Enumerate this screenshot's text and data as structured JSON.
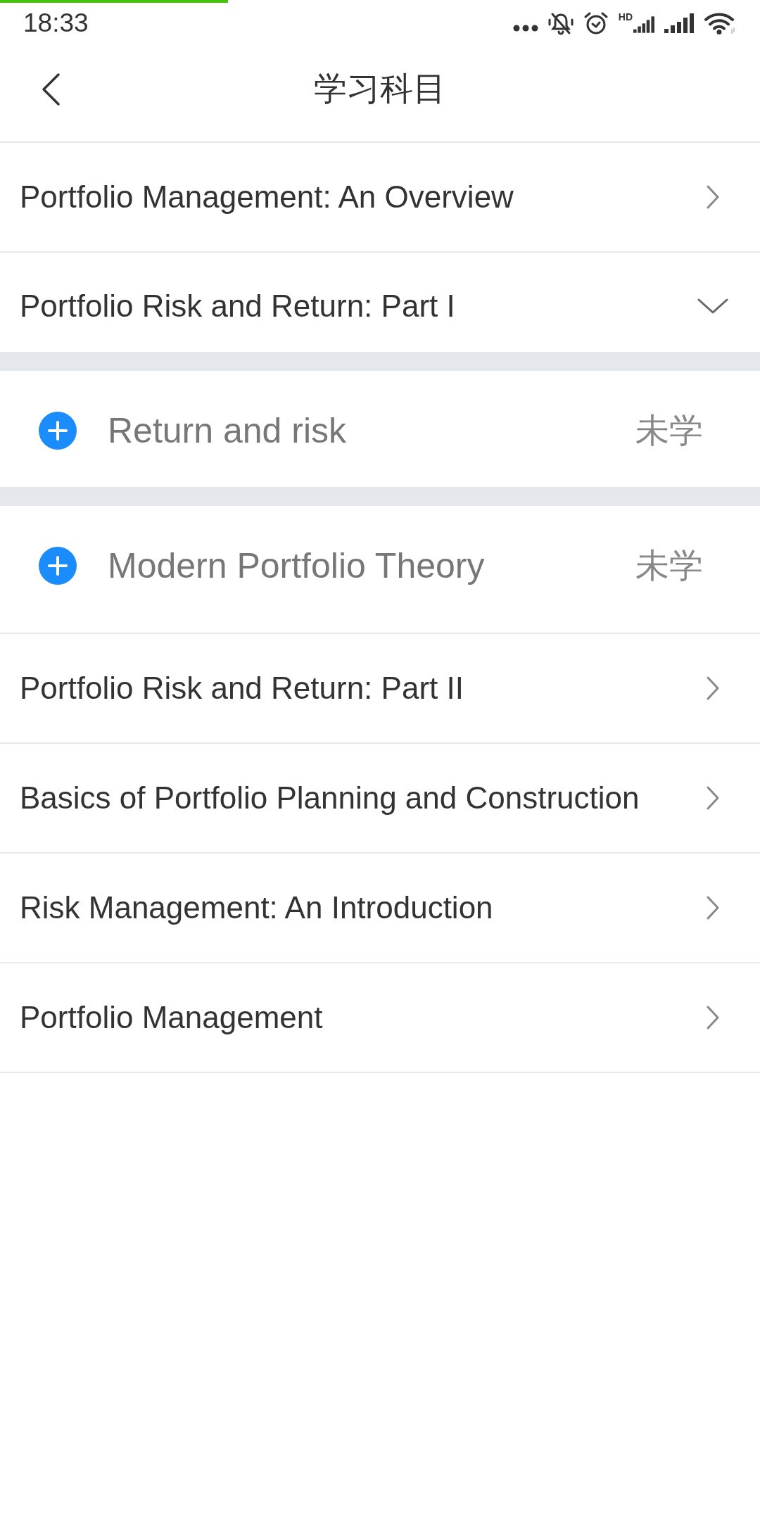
{
  "status_bar": {
    "time": "18:33",
    "network_type": "HD"
  },
  "loading_bar": {
    "level": 0.3
  },
  "header": {
    "title": "学习科目"
  },
  "chapters": [
    {
      "title": "Portfolio Management: An Overview",
      "expanded": false
    },
    {
      "title": "Portfolio Risk and Return: Part I",
      "expanded": true,
      "children": [
        {
          "title": "Return and risk",
          "status": "未学"
        },
        {
          "title": "Modern Portfolio Theory",
          "status": "未学"
        }
      ]
    },
    {
      "title": "Portfolio Risk and Return: Part II",
      "expanded": false
    },
    {
      "title": "Basics of Portfolio Planning and Construction",
      "expanded": false
    },
    {
      "title": "Risk Management: An Introduction",
      "expanded": false
    },
    {
      "title": "Portfolio Management",
      "expanded": false
    }
  ]
}
